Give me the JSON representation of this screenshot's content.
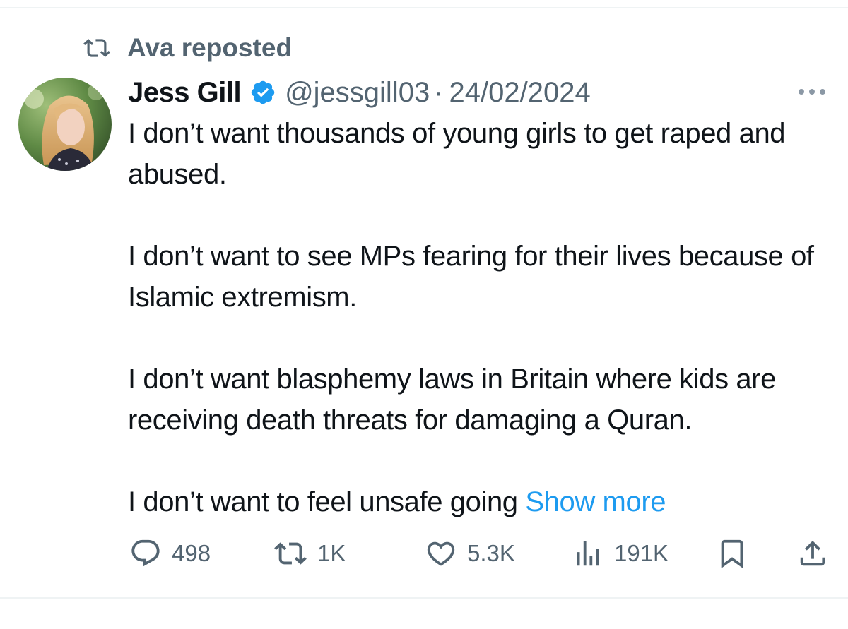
{
  "repost": {
    "text": "Ava reposted",
    "icon": "repost-icon"
  },
  "post": {
    "author_name": "Jess Gill",
    "verified": true,
    "handle": "@jessgill03",
    "separator": "·",
    "date": "24/02/2024",
    "paragraphs": [
      "I don’t want thousands of young girls to get raped and abused.",
      "I don’t want to see MPs fearing for their lives because of Islamic extremism.",
      "I don’t want blasphemy laws in Britain where kids are receiving death threats for damaging a Quran.",
      "I don’t want to feel unsafe going"
    ],
    "show_more_label": "Show more"
  },
  "actions": {
    "replies": "498",
    "reposts": "1K",
    "likes": "5.3K",
    "views": "191K"
  },
  "colors": {
    "text": "#0f1419",
    "secondary": "#536471",
    "link": "#1d9bf0",
    "verified_badge": "#1d9bf0",
    "divider": "#eff3f4"
  }
}
